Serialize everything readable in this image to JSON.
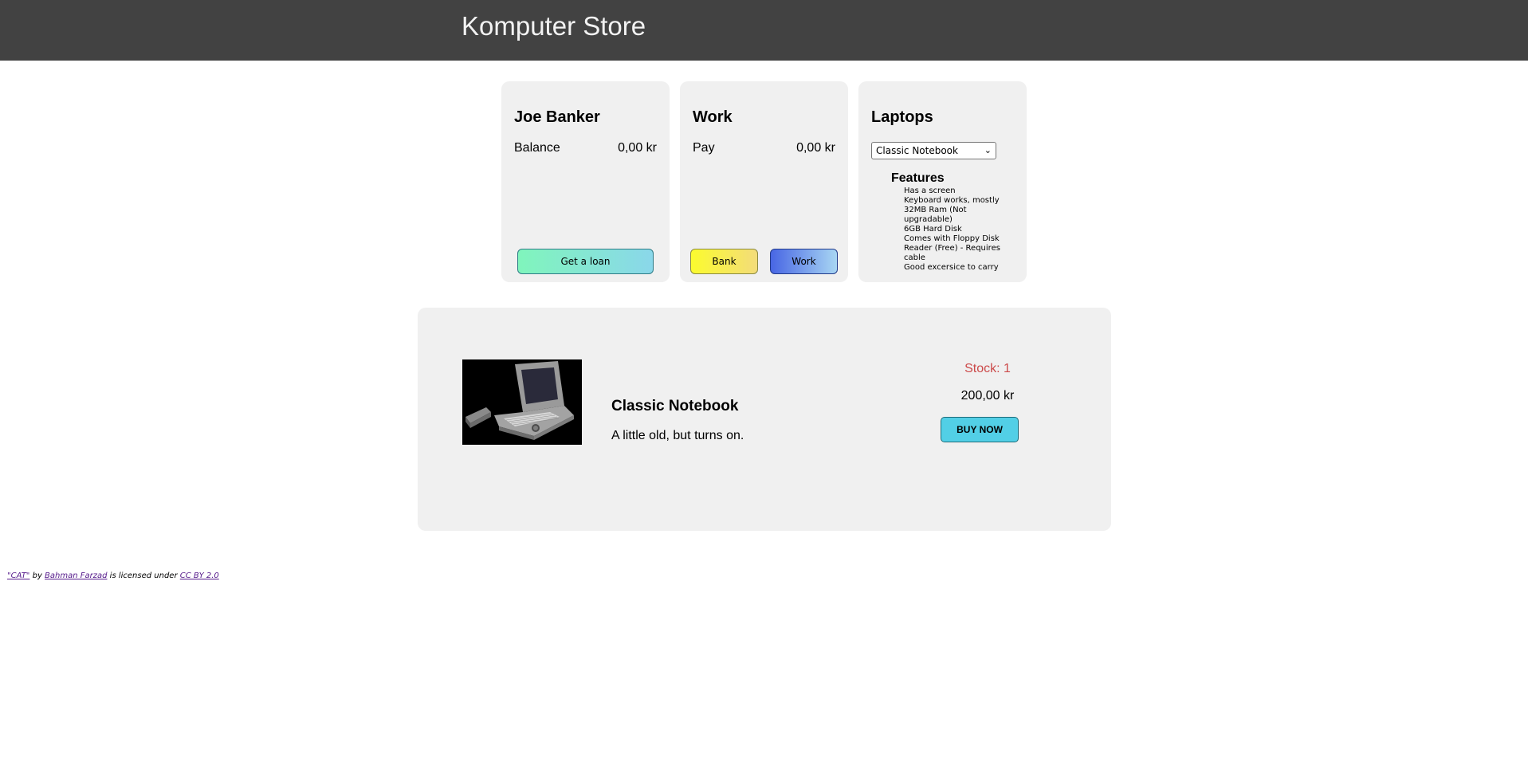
{
  "header": {
    "title": "Komputer Store"
  },
  "bank": {
    "name": "Joe Banker",
    "balance_label": "Balance",
    "balance_value": "0,00 kr",
    "loan_button": "Get a loan"
  },
  "work": {
    "title": "Work",
    "pay_label": "Pay",
    "pay_value": "0,00 kr",
    "bank_button": "Bank",
    "work_button": "Work"
  },
  "laptops": {
    "title": "Laptops",
    "selected": "Classic Notebook",
    "features_title": "Features",
    "features": [
      "Has a screen",
      "Keyboard works, mostly",
      "32MB Ram (Not upgradable)",
      "6GB Hard Disk",
      "Comes with Floppy Disk Reader (Free) - Requires cable",
      "Good excersice to carry"
    ]
  },
  "product": {
    "name": "Classic Notebook",
    "description": "A little old, but turns on.",
    "stock": "Stock: 1",
    "price": "200,00 kr",
    "buy_button": "BUY NOW"
  },
  "attribution": {
    "work_title": "\"CAT\"",
    "by": "by",
    "author": "Bahman Farzad",
    "licensed": "is licensed under",
    "license": "CC BY 2.0"
  },
  "colors": {
    "header_bg": "#424242",
    "card_bg": "#f0f0f0",
    "stock_text": "#cc4a4a",
    "buy_button": "#52cfe6"
  },
  "icons": {
    "select_arrow": "chevron-down-icon",
    "product_image": "laptop-image"
  }
}
